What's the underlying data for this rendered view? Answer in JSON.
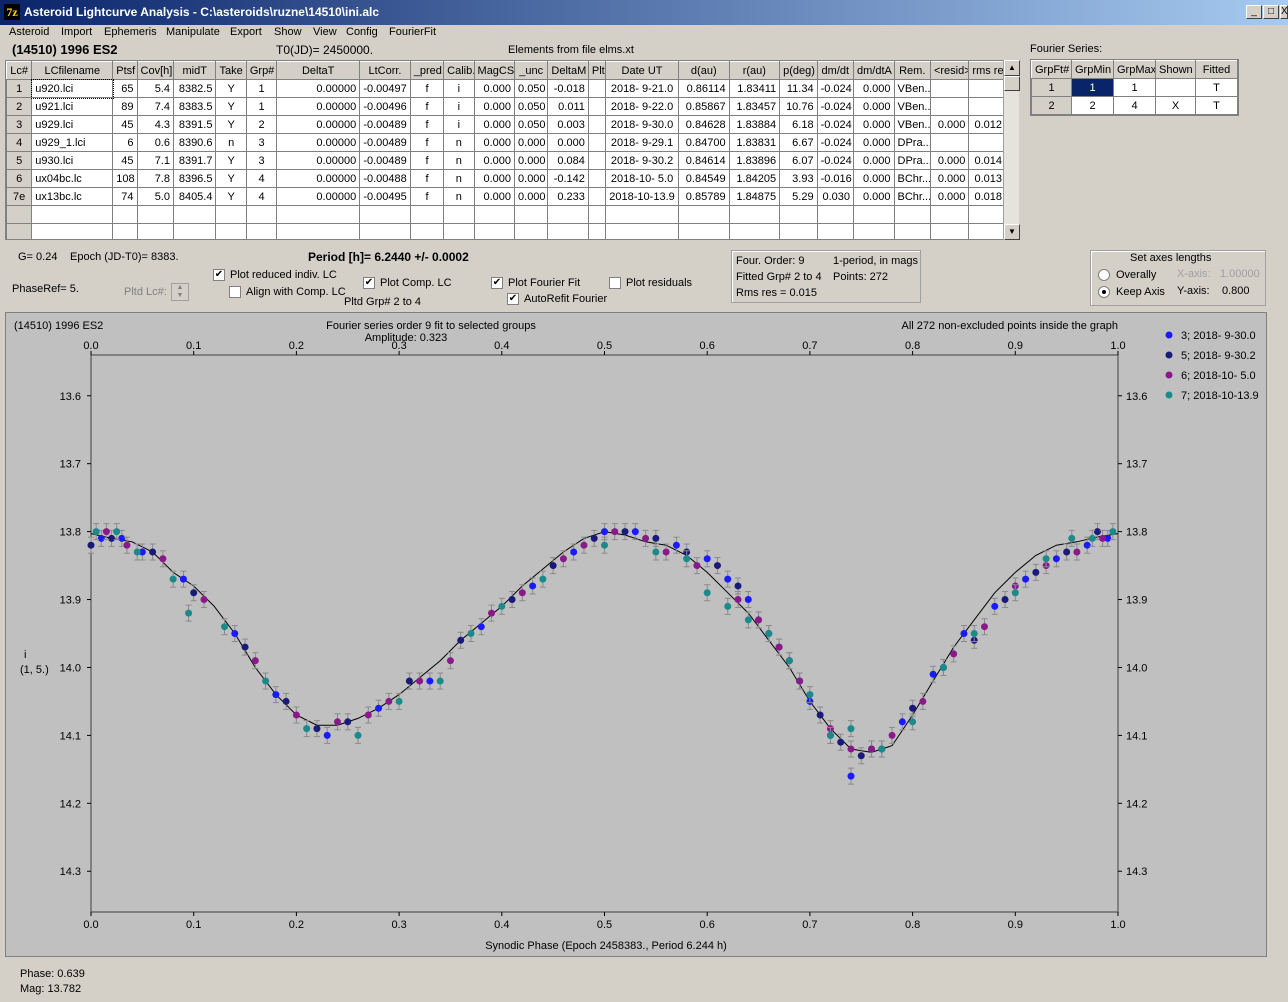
{
  "window": {
    "title": "Asteroid Lightcurve Analysis - C:\\asteroids\\ruzne\\14510\\ini.alc",
    "icon": "7z",
    "min": "_",
    "max": "□",
    "close": "X"
  },
  "menu": [
    "Asteroid",
    "Import",
    "Ephemeris",
    "Manipulate",
    "Export",
    "Show",
    "View",
    "Config",
    "FourierFit"
  ],
  "header": {
    "asteroid": "(14510) 1996 ES2",
    "t0": "T0(JD)= 2450000.",
    "elements": "Elements from file elms.xt"
  },
  "lc_table": {
    "columns": [
      "Lc#",
      "LCfilename",
      "Ptsf",
      "Cov[h]",
      "midT",
      "Take",
      "Grp#",
      "DeltaT",
      "LtCorr.",
      "_pred.",
      "Calib.",
      "MagCS",
      "_unc",
      "DeltaM",
      "Plt",
      "Date UT",
      "d(au)",
      "r(au)",
      "p(deg)",
      "dm/dt",
      "dm/dtA",
      "Rem.",
      "<resid>",
      "rms res"
    ],
    "rows": [
      [
        "1",
        "u920.lci",
        "65",
        "5.4",
        "8382.5",
        "Y",
        "1",
        "0.00000",
        "-0.00497",
        "f",
        "i",
        "0.000",
        "0.050",
        "-0.018",
        "",
        "2018- 9-21.0",
        "0.86114",
        "1.83411",
        "11.34",
        "-0.024",
        "0.000",
        "VBen...",
        "",
        ""
      ],
      [
        "2",
        "u921.lci",
        "89",
        "7.4",
        "8383.5",
        "Y",
        "1",
        "0.00000",
        "-0.00496",
        "f",
        "i",
        "0.000",
        "0.050",
        "0.011",
        "",
        "2018- 9-22.0",
        "0.85867",
        "1.83457",
        "10.76",
        "-0.024",
        "0.000",
        "VBen...",
        "",
        ""
      ],
      [
        "3",
        "u929.lci",
        "45",
        "4.3",
        "8391.5",
        "Y",
        "2",
        "0.00000",
        "-0.00489",
        "f",
        "i",
        "0.000",
        "0.050",
        "0.003",
        "",
        "2018- 9-30.0",
        "0.84628",
        "1.83884",
        "6.18",
        "-0.024",
        "0.000",
        "VBen...",
        "0.000",
        "0.012"
      ],
      [
        "4",
        "u929_1.lci",
        "6",
        "0.6",
        "8390.6",
        "n",
        "3",
        "0.00000",
        "-0.00489",
        "f",
        "n",
        "0.000",
        "0.000",
        "0.000",
        "",
        "2018- 9-29.1",
        "0.84700",
        "1.83831",
        "6.67",
        "-0.024",
        "0.000",
        "DPra...",
        "",
        ""
      ],
      [
        "5",
        "u930.lci",
        "45",
        "7.1",
        "8391.7",
        "Y",
        "3",
        "0.00000",
        "-0.00489",
        "f",
        "n",
        "0.000",
        "0.000",
        "0.084",
        "",
        "2018- 9-30.2",
        "0.84614",
        "1.83896",
        "6.07",
        "-0.024",
        "0.000",
        "DPra...",
        "0.000",
        "0.014"
      ],
      [
        "6",
        "ux04bc.lc",
        "108",
        "7.8",
        "8396.5",
        "Y",
        "4",
        "0.00000",
        "-0.00488",
        "f",
        "n",
        "0.000",
        "0.000",
        "-0.142",
        "",
        "2018-10- 5.0",
        "0.84549",
        "1.84205",
        "3.93",
        "-0.016",
        "0.000",
        "BChr...",
        "0.000",
        "0.013"
      ],
      [
        "7e",
        "ux13bc.lc",
        "74",
        "5.0",
        "8405.4",
        "Y",
        "4",
        "0.00000",
        "-0.00495",
        "f",
        "n",
        "0.000",
        "0.000",
        "0.233",
        "",
        "2018-10-13.9",
        "0.85789",
        "1.84875",
        "5.29",
        "0.030",
        "0.000",
        "BChr...",
        "0.000",
        "0.018"
      ]
    ],
    "empty_rows": 2
  },
  "fourier_series": {
    "label": "Fourier Series:",
    "columns": [
      "GrpFt#",
      "GrpMin",
      "GrpMax",
      "Shown",
      "Fitted"
    ],
    "rows": [
      [
        "1",
        "1",
        "1",
        "",
        "T"
      ],
      [
        "2",
        "2",
        "4",
        "X",
        "T"
      ]
    ]
  },
  "controls": {
    "g": "G= 0.24",
    "epoch": "Epoch (JD-T0)= 8383.",
    "period": "Period [h]= 6.2440 +/- 0.0002",
    "phase_ref": "PhaseRef= 5.",
    "pltd_lc": "Pltd Lc#:",
    "plot_reduced": "Plot reduced indiv. LC",
    "align_comp": "Align with Comp. LC",
    "plot_comp": "Plot Comp. LC",
    "pltd_grp": "Pltd Grp#  2   to   4",
    "plot_fourier": "Plot Fourier Fit",
    "autorefit": "AutoRefit Fourier",
    "plot_residuals": "Plot residuals",
    "checks": {
      "plot_reduced": true,
      "align_comp": false,
      "plot_comp": true,
      "plot_fourier": true,
      "autorefit": true,
      "plot_residuals": false
    }
  },
  "fourier_info": {
    "order": "Four. Order:  9",
    "period_note": "1-period, in mags",
    "fitted": "Fitted Grp# 2 to 4",
    "points": "Points: 272",
    "rms": "Rms res      = 0.015"
  },
  "axes_box": {
    "title": "Set axes lengths",
    "overally": "Overally",
    "keep_axis": "Keep Axis",
    "xaxis_label": "X-axis:",
    "xaxis_value": "1.00000",
    "yaxis_label": "Y-axis:",
    "yaxis_value": "0.800",
    "selected": "keep_axis"
  },
  "status": {
    "phase": "Phase:  0.639",
    "mag": "Mag:    13.782"
  },
  "chart_data": {
    "type": "scatter",
    "title_left": "(14510) 1996 ES2",
    "title": "Fourier series order 9 fit to selected groups",
    "subtitle": "Amplitude: 0.323",
    "note": "All 272 non-excluded points inside the graph",
    "xlabel": "Synodic Phase (Epoch 2458383., Period 6.244 h)",
    "ylabel": "i\n(1, 5.)",
    "ylabel_line1": "i",
    "ylabel_line2": "(1, 5.)",
    "xlim": [
      0.0,
      1.0
    ],
    "ylim": [
      13.54,
      14.36
    ],
    "y_inverted": true,
    "xticks": [
      "0.0",
      "0.1",
      "0.2",
      "0.3",
      "0.4",
      "0.5",
      "0.6",
      "0.7",
      "0.8",
      "0.9",
      "1.0"
    ],
    "yticks": [
      "13.6",
      "13.7",
      "13.8",
      "13.9",
      "14.0",
      "14.1",
      "14.2",
      "14.3"
    ],
    "background": "#c0c0c0",
    "fit_curve": {
      "x": [
        0.0,
        0.02,
        0.04,
        0.06,
        0.08,
        0.1,
        0.12,
        0.14,
        0.16,
        0.18,
        0.2,
        0.22,
        0.24,
        0.26,
        0.28,
        0.3,
        0.32,
        0.34,
        0.36,
        0.38,
        0.4,
        0.42,
        0.44,
        0.46,
        0.48,
        0.5,
        0.52,
        0.54,
        0.56,
        0.58,
        0.6,
        0.62,
        0.64,
        0.66,
        0.68,
        0.7,
        0.72,
        0.74,
        0.76,
        0.78,
        0.8,
        0.82,
        0.84,
        0.86,
        0.88,
        0.9,
        0.92,
        0.94,
        0.96,
        0.98,
        1.0
      ],
      "y": [
        13.803,
        13.81,
        13.815,
        13.83,
        13.86,
        13.88,
        13.91,
        13.95,
        14.0,
        14.04,
        14.07,
        14.085,
        14.085,
        14.075,
        14.06,
        14.04,
        14.015,
        13.99,
        13.96,
        13.935,
        13.91,
        13.88,
        13.855,
        13.83,
        13.81,
        13.8,
        13.805,
        13.815,
        13.82,
        13.835,
        13.86,
        13.89,
        13.92,
        13.96,
        14.0,
        14.05,
        14.09,
        14.12,
        14.125,
        14.115,
        14.07,
        14.02,
        13.97,
        13.93,
        13.89,
        13.86,
        13.835,
        13.82,
        13.815,
        13.808,
        13.803
      ],
      "color": "#000000"
    },
    "series": [
      {
        "name": "3; 2018- 9-30.0",
        "color": "#1a1aff",
        "x": [
          0.01,
          0.03,
          0.05,
          0.09,
          0.14,
          0.18,
          0.23,
          0.28,
          0.33,
          0.38,
          0.43,
          0.47,
          0.5,
          0.53,
          0.57,
          0.6,
          0.62,
          0.64,
          0.66,
          0.68,
          0.7,
          0.72,
          0.74,
          0.76,
          0.79,
          0.82,
          0.85,
          0.88,
          0.91,
          0.94,
          0.97,
          0.99
        ],
        "y": [
          13.81,
          13.81,
          13.83,
          13.87,
          13.95,
          14.04,
          14.1,
          14.06,
          14.02,
          13.94,
          13.88,
          13.83,
          13.8,
          13.8,
          13.82,
          13.84,
          13.87,
          13.9,
          13.95,
          13.99,
          14.05,
          14.1,
          14.16,
          14.12,
          14.08,
          14.01,
          13.95,
          13.91,
          13.87,
          13.84,
          13.82,
          13.81
        ]
      },
      {
        "name": "5; 2018- 9-30.2",
        "color": "#1a1a7a",
        "x": [
          0.0,
          0.02,
          0.06,
          0.1,
          0.15,
          0.19,
          0.22,
          0.25,
          0.31,
          0.36,
          0.41,
          0.45,
          0.49,
          0.52,
          0.55,
          0.58,
          0.61,
          0.63,
          0.65,
          0.67,
          0.69,
          0.71,
          0.73,
          0.75,
          0.77,
          0.8,
          0.83,
          0.86,
          0.89,
          0.92,
          0.95,
          0.98
        ],
        "y": [
          13.82,
          13.81,
          13.83,
          13.89,
          13.97,
          14.05,
          14.09,
          14.08,
          14.02,
          13.96,
          13.9,
          13.85,
          13.81,
          13.8,
          13.81,
          13.83,
          13.85,
          13.88,
          13.93,
          13.97,
          14.02,
          14.07,
          14.11,
          14.13,
          14.12,
          14.06,
          14.0,
          13.96,
          13.9,
          13.86,
          13.83,
          13.8
        ]
      },
      {
        "name": "6; 2018-10- 5.0",
        "color": "#8a1a8a",
        "x": [
          0.015,
          0.035,
          0.07,
          0.11,
          0.16,
          0.2,
          0.24,
          0.27,
          0.29,
          0.32,
          0.35,
          0.39,
          0.42,
          0.46,
          0.48,
          0.51,
          0.54,
          0.56,
          0.59,
          0.63,
          0.65,
          0.67,
          0.69,
          0.72,
          0.74,
          0.76,
          0.78,
          0.81,
          0.84,
          0.87,
          0.9,
          0.93,
          0.96,
          0.985
        ],
        "y": [
          13.8,
          13.82,
          13.84,
          13.9,
          13.99,
          14.07,
          14.08,
          14.07,
          14.05,
          14.02,
          13.99,
          13.92,
          13.89,
          13.84,
          13.82,
          13.8,
          13.81,
          13.83,
          13.85,
          13.9,
          13.93,
          13.97,
          14.02,
          14.09,
          14.12,
          14.12,
          14.1,
          14.05,
          13.98,
          13.94,
          13.88,
          13.85,
          13.83,
          13.81
        ]
      },
      {
        "name": "7; 2018-10-13.9",
        "color": "#1a8a8a",
        "x": [
          0.005,
          0.025,
          0.045,
          0.08,
          0.095,
          0.13,
          0.17,
          0.21,
          0.26,
          0.3,
          0.34,
          0.37,
          0.4,
          0.44,
          0.5,
          0.55,
          0.58,
          0.6,
          0.62,
          0.64,
          0.66,
          0.68,
          0.7,
          0.72,
          0.74,
          0.77,
          0.8,
          0.83,
          0.86,
          0.9,
          0.93,
          0.955,
          0.975,
          0.995
        ],
        "y": [
          13.8,
          13.8,
          13.83,
          13.87,
          13.92,
          13.94,
          14.02,
          14.09,
          14.1,
          14.05,
          14.02,
          13.95,
          13.91,
          13.87,
          13.82,
          13.83,
          13.84,
          13.89,
          13.91,
          13.93,
          13.95,
          13.99,
          14.04,
          14.1,
          14.09,
          14.12,
          14.08,
          14.0,
          13.95,
          13.89,
          13.84,
          13.81,
          13.81,
          13.8
        ]
      }
    ]
  }
}
